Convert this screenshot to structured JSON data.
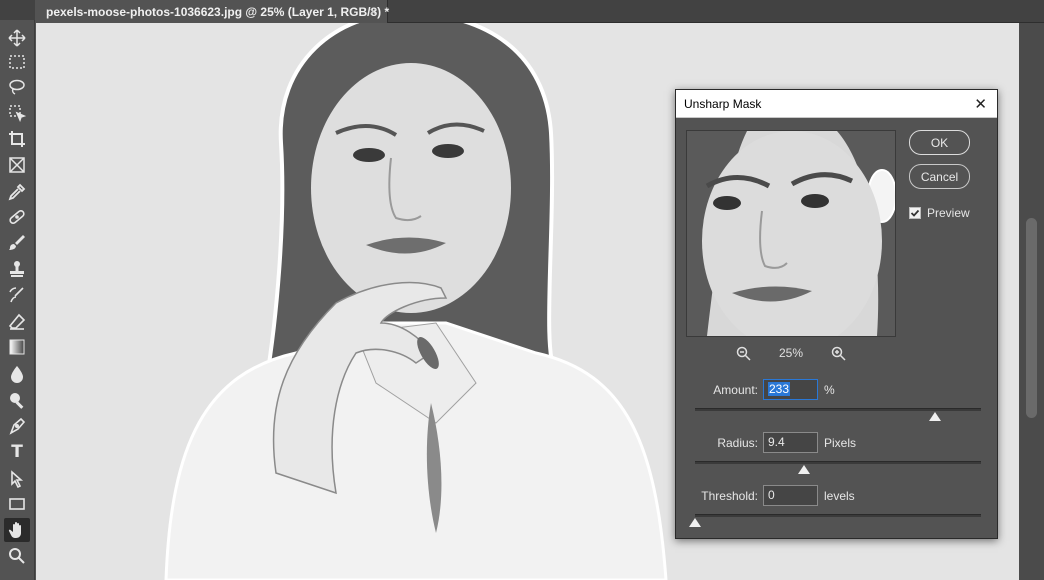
{
  "document": {
    "tab_title": "pexels-moose-photos-1036623.jpg @ 25% (Layer 1, RGB/8) *",
    "close_glyph": "×"
  },
  "toolbar": {
    "tools": [
      {
        "name": "move-tool",
        "icon": "move-icon"
      },
      {
        "name": "marquee-tool",
        "icon": "rect-marquee-icon"
      },
      {
        "name": "lasso-tool",
        "icon": "lasso-icon"
      },
      {
        "name": "object-selection-tool",
        "icon": "object-select-icon"
      },
      {
        "name": "crop-tool",
        "icon": "crop-icon"
      },
      {
        "name": "frame-tool",
        "icon": "frame-icon"
      },
      {
        "name": "eyedropper-tool",
        "icon": "eyedropper-icon"
      },
      {
        "name": "healing-brush-tool",
        "icon": "bandage-icon"
      },
      {
        "name": "brush-tool",
        "icon": "brush-icon"
      },
      {
        "name": "clone-stamp-tool",
        "icon": "stamp-icon"
      },
      {
        "name": "history-brush-tool",
        "icon": "history-brush-icon"
      },
      {
        "name": "eraser-tool",
        "icon": "eraser-icon"
      },
      {
        "name": "gradient-tool",
        "icon": "gradient-icon"
      },
      {
        "name": "blur-tool",
        "icon": "drop-icon"
      },
      {
        "name": "dodge-tool",
        "icon": "dodge-icon"
      },
      {
        "name": "pen-tool",
        "icon": "pen-icon"
      },
      {
        "name": "type-tool",
        "icon": "type-icon"
      },
      {
        "name": "path-selection-tool",
        "icon": "arrow-icon"
      },
      {
        "name": "rectangle-tool",
        "icon": "rectangle-icon"
      },
      {
        "name": "hand-tool",
        "icon": "hand-icon",
        "active": true
      },
      {
        "name": "zoom-tool",
        "icon": "zoom-icon"
      }
    ],
    "type_glyph": "T"
  },
  "dialog": {
    "title": "Unsharp Mask",
    "close_glyph": "✕",
    "ok_label": "OK",
    "cancel_label": "Cancel",
    "preview_label": "Preview",
    "preview_checked": true,
    "zoom_level": "25%",
    "amount": {
      "label": "Amount:",
      "value": "233",
      "unit": "%",
      "slider_fraction": 0.84
    },
    "radius": {
      "label": "Radius:",
      "value": "9.4",
      "unit": "Pixels",
      "slider_fraction": 0.38
    },
    "threshold": {
      "label": "Threshold:",
      "value": "0",
      "unit": "levels",
      "slider_fraction": 0.0
    }
  },
  "colors": {
    "ui_dark": "#535353",
    "focus_blue": "#2a78d6",
    "canvas_bg": "#e6e6e6"
  }
}
